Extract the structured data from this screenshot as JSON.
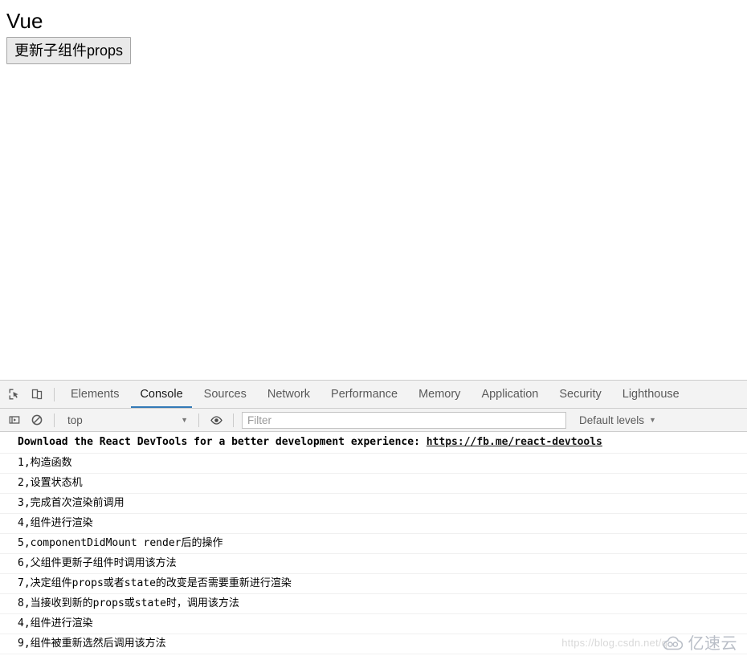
{
  "page": {
    "title": "Vue",
    "update_button_label": "更新子组件props"
  },
  "devtools": {
    "icons": {
      "inspect": "inspect-element-icon",
      "device": "device-toolbar-icon",
      "context": "execution-context-icon",
      "clear": "clear-console-icon",
      "eye": "eye-icon"
    },
    "tabs": [
      {
        "label": "Elements",
        "active": false
      },
      {
        "label": "Console",
        "active": true
      },
      {
        "label": "Sources",
        "active": false
      },
      {
        "label": "Network",
        "active": false
      },
      {
        "label": "Performance",
        "active": false
      },
      {
        "label": "Memory",
        "active": false
      },
      {
        "label": "Application",
        "active": false
      },
      {
        "label": "Security",
        "active": false
      },
      {
        "label": "Lighthouse",
        "active": false
      }
    ],
    "console_toolbar": {
      "context_value": "top",
      "filter_placeholder": "Filter",
      "filter_value": "",
      "levels_label": "Default levels",
      "caret": "▼"
    },
    "console_messages": [
      {
        "text": "Download the React DevTools for a better development experience: ",
        "link": "https://fb.me/react-devtools",
        "bold": true
      },
      {
        "text": "1,构造函数",
        "link": "",
        "bold": false
      },
      {
        "text": "2,设置状态机",
        "link": "",
        "bold": false
      },
      {
        "text": "3,完成首次渲染前调用",
        "link": "",
        "bold": false
      },
      {
        "text": "4,组件进行渲染",
        "link": "",
        "bold": false
      },
      {
        "text": "5,componentDidMount render后的操作",
        "link": "",
        "bold": false
      },
      {
        "text": "6,父组件更新子组件时调用该方法",
        "link": "",
        "bold": false
      },
      {
        "text": "7,决定组件props或者state的改变是否需要重新进行渲染",
        "link": "",
        "bold": false
      },
      {
        "text": "8,当接收到新的props或state时，调用该方法",
        "link": "",
        "bold": false
      },
      {
        "text": "4,组件进行渲染",
        "link": "",
        "bold": false
      },
      {
        "text": "9,组件被重新选然后调用该方法",
        "link": "",
        "bold": false
      }
    ]
  },
  "watermark": {
    "url": "https://blog.csdn.net/q",
    "brand": "亿速云"
  },
  "colors": {
    "accent": "#337ab7",
    "toolbar_bg": "#f3f3f3",
    "border": "#cdcdcd",
    "watermark": "#d9d9d9"
  }
}
